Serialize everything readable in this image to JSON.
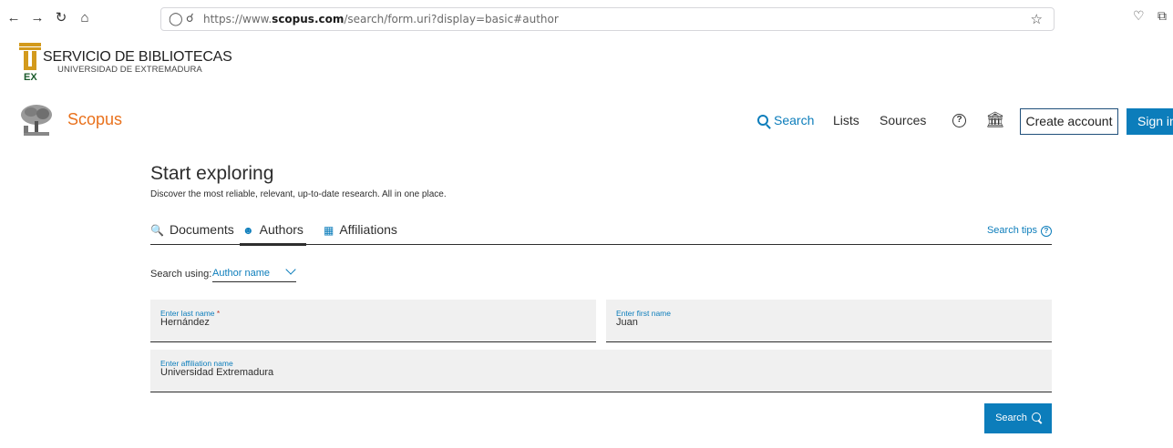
{
  "browser": {
    "url_prefix": "https://www.",
    "url_domain": "scopus.com",
    "url_path": "/search/form.uri?display=basic#author",
    "icons": [
      "back-icon",
      "forward-icon",
      "reload-icon",
      "home-icon",
      "shield-icon",
      "lock-icon",
      "bookmark-star-icon",
      "pocket-icon",
      "extensions-icon"
    ]
  },
  "library": {
    "title": "SERVICIO DE BIBLIOTECAS",
    "subtitle": "UNIVERSIDAD DE EXTREMADURA",
    "logo_letters": "EX"
  },
  "header": {
    "brand": "Scopus",
    "nav": {
      "search": "Search",
      "lists": "Lists",
      "sources": "Sources"
    },
    "help": "?",
    "create_account": "Create account",
    "sign_in": "Sign in"
  },
  "main": {
    "title": "Start exploring",
    "subtitle": "Discover the most reliable, relevant, up-to-date research. All in one place.",
    "tabs": [
      {
        "label": "Documents",
        "icon": "document-search-icon"
      },
      {
        "label": "Authors",
        "icon": "person-icon",
        "active": true
      },
      {
        "label": "Affiliations",
        "icon": "building-icon"
      }
    ],
    "search_tips": "Search tips",
    "search_using_label": "Search using:",
    "search_using_value": "Author name",
    "fields": {
      "last_name_label": "Enter last name",
      "last_name_required": "*",
      "last_name_value": "Hernández",
      "first_name_label": "Enter first name",
      "first_name_value": "Juan",
      "affiliation_label": "Enter affiliation name",
      "affiliation_value": "Universidad Extremadura"
    },
    "search_button": "Search"
  },
  "colors": {
    "accent": "#0c7dbb",
    "brand_orange": "#e9711c",
    "text": "#2e2e2e",
    "field_bg": "#f0f0f0"
  }
}
